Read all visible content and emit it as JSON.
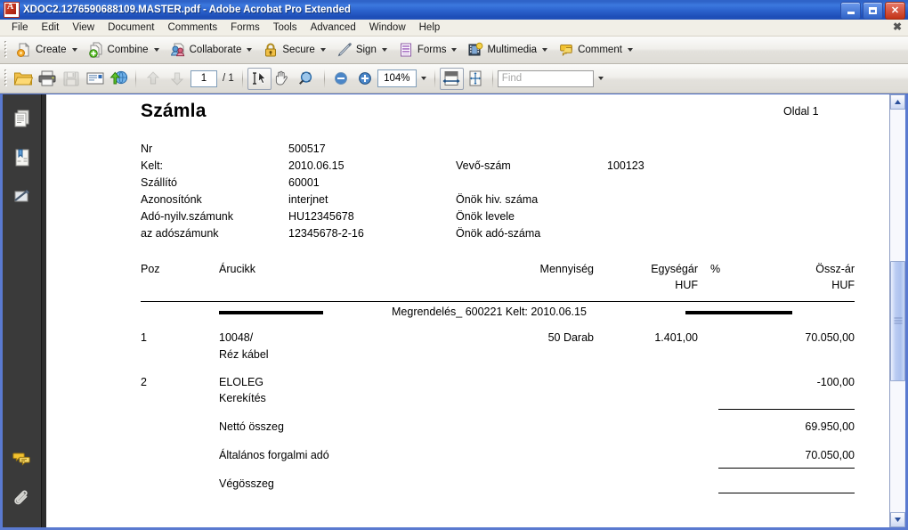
{
  "window": {
    "title": "XDOC2.1276590688109.MASTER.pdf - Adobe Acrobat Pro Extended",
    "app_icon": "acrobat-pdf-icon",
    "minimize_label": "Minimize",
    "maximize_label": "Maximize",
    "close_label": "Close"
  },
  "menubar": {
    "items": [
      {
        "label": "File"
      },
      {
        "label": "Edit"
      },
      {
        "label": "View"
      },
      {
        "label": "Document"
      },
      {
        "label": "Comments"
      },
      {
        "label": "Forms"
      },
      {
        "label": "Tools"
      },
      {
        "label": "Advanced"
      },
      {
        "label": "Window"
      },
      {
        "label": "Help"
      }
    ],
    "close_document_label": "✖"
  },
  "toolbar_main": {
    "buttons": [
      {
        "label": "Create",
        "icon": "create-pdf-icon",
        "dropdown": true
      },
      {
        "label": "Combine",
        "icon": "combine-files-icon",
        "dropdown": true
      },
      {
        "label": "Collaborate",
        "icon": "collaborate-icon",
        "dropdown": true
      },
      {
        "label": "Secure",
        "icon": "lock-icon",
        "dropdown": true
      },
      {
        "label": "Sign",
        "icon": "pen-sign-icon",
        "dropdown": true
      },
      {
        "label": "Forms",
        "icon": "forms-icon",
        "dropdown": true
      },
      {
        "label": "Multimedia",
        "icon": "multimedia-film-icon",
        "dropdown": true
      },
      {
        "label": "Comment",
        "icon": "comment-bubble-icon",
        "dropdown": true
      }
    ]
  },
  "toolbar_file": {
    "open_label": "Open",
    "print_label": "Print",
    "save_label": "Save",
    "email_label": "Email",
    "upload_label": "Upload",
    "prev_page_label": "Previous Page",
    "next_page_label": "Next Page",
    "page_number": "1",
    "page_of": "/ 1",
    "select_tool_label": "Select Tool",
    "hand_tool_label": "Hand Tool",
    "marquee_zoom_label": "Marquee Zoom",
    "zoom_out_label": "Zoom Out",
    "zoom_in_label": "Zoom In",
    "zoom_value": "104%",
    "fit_width_label": "Fit Width",
    "fit_page_label": "Fit Page",
    "find_placeholder": "Find"
  },
  "navpane": {
    "items": [
      {
        "name": "pages-panel",
        "icon": "pages-thumbnail-icon",
        "label": "Pages"
      },
      {
        "name": "bookmarks-panel",
        "icon": "bookmarks-icon",
        "label": "Bookmarks"
      },
      {
        "name": "signatures-panel",
        "icon": "signatures-icon",
        "label": "Signatures"
      },
      {
        "name": "comments-panel",
        "icon": "comments-icon",
        "label": "Comments"
      },
      {
        "name": "attachments-panel",
        "icon": "paperclip-icon",
        "label": "Attachments"
      }
    ]
  },
  "document": {
    "title": "Számla",
    "page_label": "Oldal 1",
    "meta_left": [
      {
        "label": "Nr",
        "value": "500517"
      },
      {
        "label": "Kelt:",
        "value": "2010.06.15"
      },
      {
        "label": "Szállító",
        "value": "60001"
      },
      {
        "label": "Azonosítónk",
        "value": "interjnet"
      },
      {
        "label": "Adó-nyilv.számunk",
        "value": "HU12345678"
      },
      {
        "label": "az adószámunk",
        "value": "12345678-2-16"
      }
    ],
    "meta_right": [
      {
        "label": "Vevő-szám",
        "value": "100123"
      },
      {
        "label": "Önök hiv. száma",
        "value": ""
      },
      {
        "label": "Önök levele",
        "value": ""
      },
      {
        "label": "Önök adó-száma",
        "value": ""
      }
    ],
    "table_headers": {
      "pos": "Poz",
      "item": "Árucikk",
      "quantity": "Mennyiség",
      "unit_price": "Egységár",
      "unit_price_currency": "HUF",
      "percent": "%",
      "total": "Össz-ár",
      "total_currency": "HUF"
    },
    "order_line": "Megrendelés_ 600221 Kelt: 2010.06.15",
    "rows": [
      {
        "pos": "1",
        "item": "10048/",
        "item2": "Réz kábel",
        "quantity": "50 Darab",
        "unit_price": "1.401,00",
        "percent": "",
        "total": "70.050,00"
      },
      {
        "pos": "2",
        "item": "ELOLEG",
        "item2": "Kerekítés",
        "quantity": "",
        "unit_price": "",
        "percent": "",
        "total": "-100,00"
      }
    ],
    "totals": [
      {
        "label": "Nettó összeg",
        "value": "69.950,00"
      },
      {
        "label": "Általános forgalmi adó",
        "value": "70.050,00"
      },
      {
        "label": "Végösszeg",
        "value": ""
      }
    ]
  },
  "scrollbar": {
    "up_label": "Scroll Up",
    "down_label": "Scroll Down"
  },
  "colors": {
    "titlebar": "#2f63c8",
    "toolbar": "#eceae5",
    "navpane": "#3a3a3a",
    "page": "#ffffff",
    "accent": "#5a7ad0"
  }
}
